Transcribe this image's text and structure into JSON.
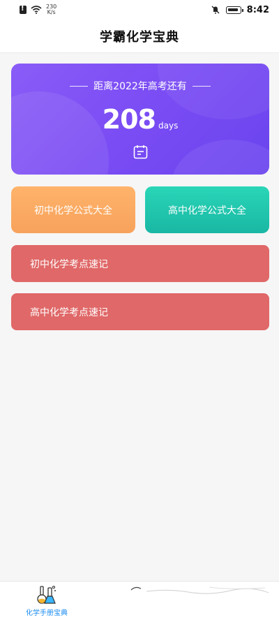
{
  "status_bar": {
    "network_speed_value": "230",
    "network_speed_unit": "K/s",
    "time": "8:42"
  },
  "header": {
    "title": "学霸化学宝典"
  },
  "countdown": {
    "label": "距离2022年高考还有",
    "days": "208",
    "unit": "days",
    "icon": "calendar-icon"
  },
  "formula_buttons": [
    {
      "label": "初中化学公式大全",
      "color": "#f7a25c"
    },
    {
      "label": "高中化学公式大全",
      "color": "#19b7a4"
    }
  ],
  "recall_buttons": [
    {
      "label": "初中化学考点速记",
      "color": "#e06868"
    },
    {
      "label": "高中化学考点速记",
      "color": "#e06868"
    }
  ],
  "bottom_nav": {
    "items": [
      {
        "label": "化学手册宝典",
        "icon": "flask-icon",
        "active": true
      }
    ],
    "active_color": "#1f8ef1"
  },
  "colors": {
    "countdown_card": "#7a4cf4",
    "background": "#f6f6f6"
  }
}
